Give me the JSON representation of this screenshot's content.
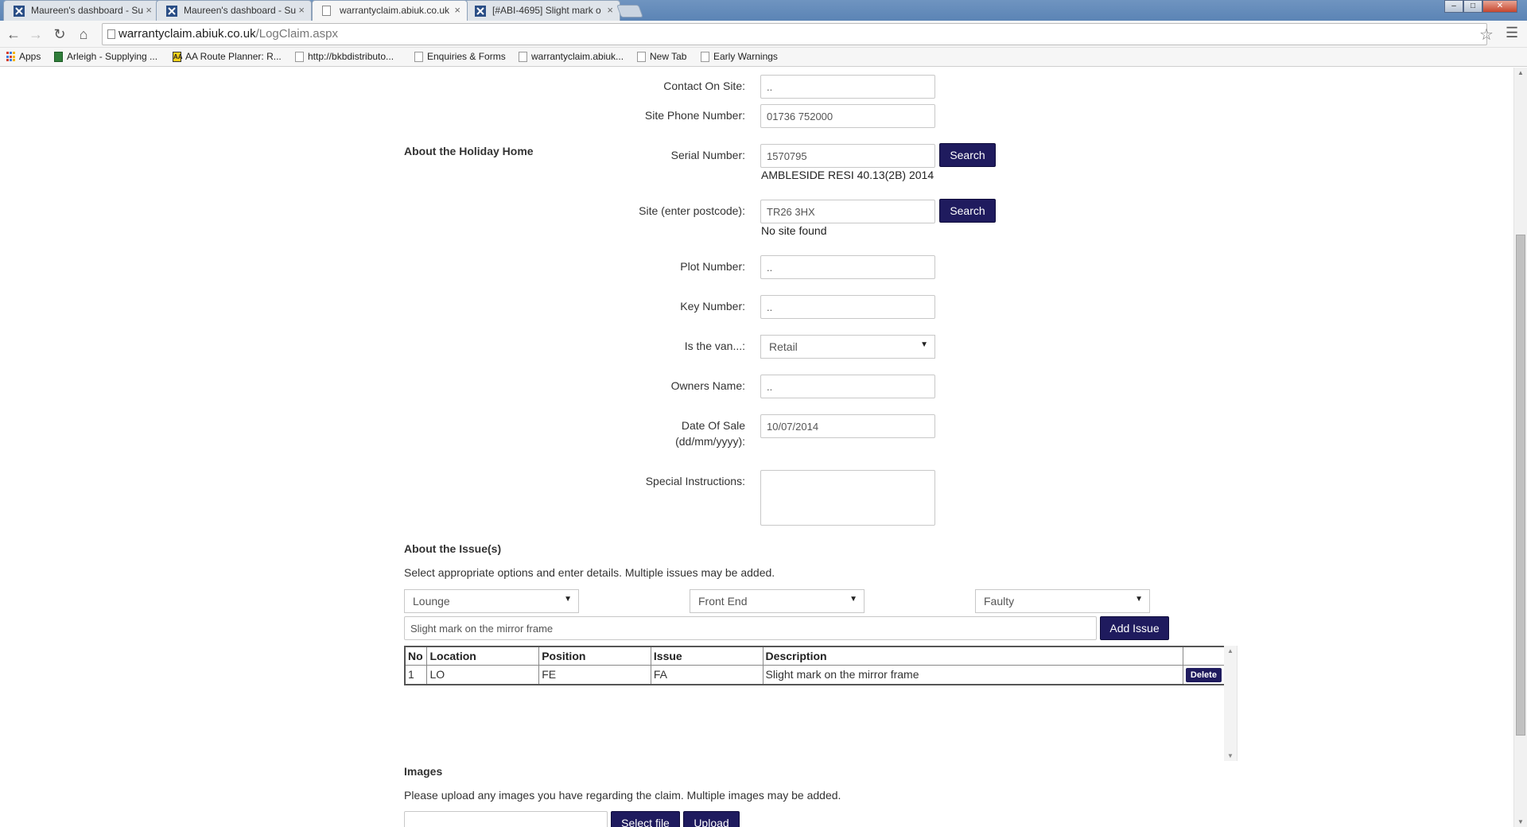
{
  "browser": {
    "tabs": [
      {
        "title": "Maureen's dashboard - Su",
        "active": false
      },
      {
        "title": "Maureen's dashboard - Su",
        "active": false
      },
      {
        "title": "warrantyclaim.abiuk.co.uk",
        "active": true
      },
      {
        "title": "[#ABI-4695] Slight mark o",
        "active": false
      }
    ],
    "url_host": "warrantyclaim.abiuk.co.uk",
    "url_path": "/LogClaim.aspx",
    "bookmarks": [
      {
        "label": "Apps",
        "icon": "apps-icon"
      },
      {
        "label": "Arleigh - Supplying ...",
        "icon": "arleigh-icon"
      },
      {
        "label": "AA Route Planner: R...",
        "icon": "aa-icon"
      },
      {
        "label": "http://bkbdistributo...",
        "icon": "page-icon"
      },
      {
        "label": "Enquiries & Forms",
        "icon": "page-icon"
      },
      {
        "label": "warrantyclaim.abiuk...",
        "icon": "page-icon"
      },
      {
        "label": "New Tab",
        "icon": "page-icon"
      },
      {
        "label": "Early Warnings",
        "icon": "page-icon"
      }
    ]
  },
  "form": {
    "contact_on_site": {
      "label": "Contact On Site:",
      "value": ".."
    },
    "site_phone": {
      "label": "Site Phone Number:",
      "value": "01736 752000"
    },
    "holiday_home_heading": "About the Holiday Home",
    "serial_number": {
      "label": "Serial Number:",
      "value": "1570795",
      "button": "Search",
      "result": "AMBLESIDE RESI 40.13(2B) 2014"
    },
    "site_postcode": {
      "label": "Site (enter postcode):",
      "value": "TR26 3HX",
      "button": "Search",
      "result": "No site found"
    },
    "plot_number": {
      "label": "Plot Number:",
      "value": ".."
    },
    "key_number": {
      "label": "Key Number:",
      "value": ".."
    },
    "is_the_van": {
      "label": "Is the van...:",
      "value": "Retail"
    },
    "owners_name": {
      "label": "Owners Name:",
      "value": ".."
    },
    "date_of_sale": {
      "label_line1": "Date Of Sale",
      "label_line2": "(dd/mm/yyyy):",
      "value": "10/07/2014"
    },
    "special_instructions": {
      "label": "Special Instructions:",
      "value": ""
    }
  },
  "issues": {
    "heading": "About the Issue(s)",
    "instructions": "Select appropriate options and enter details. Multiple issues may be added.",
    "location_select": "Lounge",
    "position_select": "Front End",
    "issue_select": "Faulty",
    "description_input": "Slight mark on the mirror frame",
    "add_button": "Add Issue",
    "columns": [
      "No",
      "Location",
      "Position",
      "Issue",
      "Description",
      ""
    ],
    "rows": [
      {
        "no": "1",
        "location": "LO",
        "position": "FE",
        "issue": "FA",
        "description": "Slight mark on the mirror frame",
        "action": "Delete"
      }
    ]
  },
  "images": {
    "heading": "Images",
    "instructions": "Please upload any images you have regarding the claim. Multiple images may be added.",
    "select_button": "Select file",
    "upload_button": "Upload"
  },
  "colors": {
    "button_bg": "#1f1b5e",
    "tabbar_bg": "#5b84b5"
  }
}
